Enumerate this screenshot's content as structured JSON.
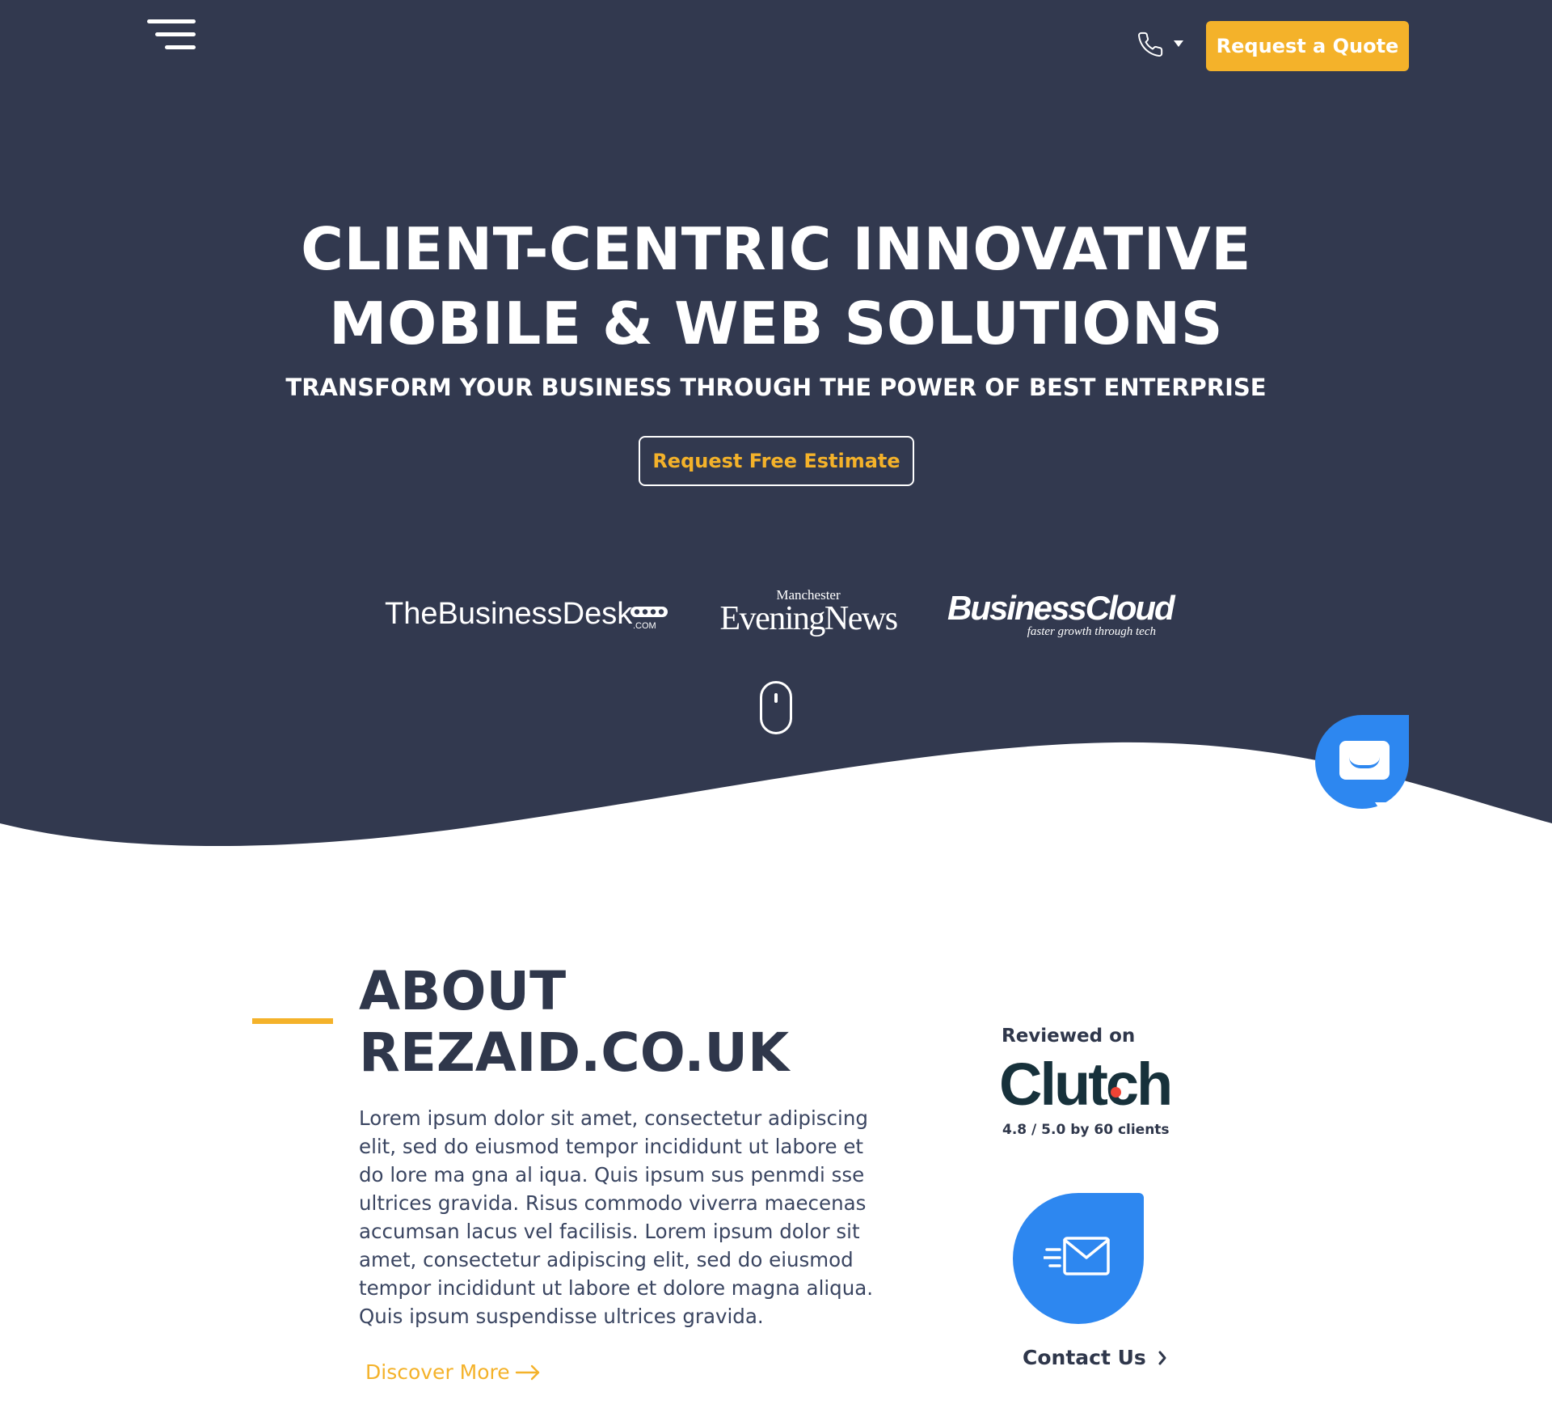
{
  "colors": {
    "hero_bg": "#32394f",
    "accent": "#f4b22a",
    "blue": "#2d87f0",
    "heading": "#2f374b"
  },
  "header": {
    "menu_icon": "hamburger-menu-icon",
    "phone_icon": "phone-icon",
    "quote_button": "Request a Quote"
  },
  "hero": {
    "title_line1": "CLIENT-CENTRIC INNOVATIVE",
    "title_line2": "MOBILE & WEB SOLUTIONS",
    "subtitle": "TRANSFORM YOUR BUSINESS THROUGH THE POWER OF BEST ENTERPRISE",
    "cta": "Request Free Estimate"
  },
  "press": {
    "businessdesk_the": "The",
    "businessdesk_name": "BusinessDesk",
    "businessdesk_com": ".COM",
    "men_top": "Manchester",
    "men_main": "EveningNews",
    "businesscloud_name": "BusinessCloud",
    "businesscloud_tagline": "faster growth through tech"
  },
  "about": {
    "title_line1": "ABOUT",
    "title_line2": "REZAID.CO.UK",
    "body": "Lorem ipsum dolor sit amet, consectetur adipiscing elit, sed do eiusmod tempor incididunt ut labore et do lore ma gna al iqua. Quis ipsum sus penmdi sse ultrices gravida. Risus commodo viverra maecenas accumsan lacus vel facilisis. Lorem ipsum dolor sit amet, consectetur adipiscing elit, sed do eiusmod tempor incididunt ut labore et dolore magna aliqua. Quis ipsum suspendisse ultrices gravida.",
    "discover_more": "Discover More"
  },
  "review": {
    "label": "Reviewed on",
    "brand": "Clutch",
    "rating": "4.8 / 5.0 by 60 clients"
  },
  "contact": {
    "label": "Contact Us",
    "icon": "mail-icon"
  }
}
